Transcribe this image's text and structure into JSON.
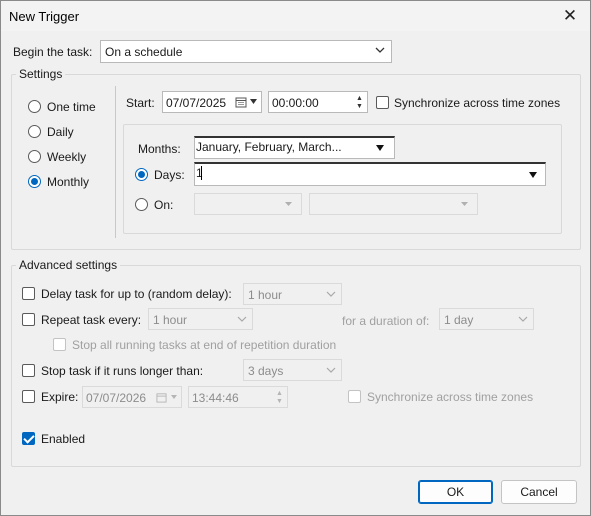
{
  "window": {
    "title": "New Trigger"
  },
  "begin_task": {
    "label": "Begin the task:",
    "value": "On a schedule"
  },
  "settings": {
    "group_title": "Settings",
    "schedule_options": [
      "One time",
      "Daily",
      "Weekly",
      "Monthly"
    ],
    "selected_option": "Monthly",
    "start_label": "Start:",
    "start_date": "07/07/2025",
    "start_time": "00:00:00",
    "sync_label": "Synchronize across time zones",
    "months_label": "Months:",
    "months_value": "January, February, March...",
    "days_label": "Days:",
    "days_value": "1",
    "on_label": "On:"
  },
  "advanced": {
    "group_title": "Advanced settings",
    "delay_label": "Delay task for up to (random delay):",
    "delay_value": "1 hour",
    "repeat_label": "Repeat task every:",
    "repeat_value": "1 hour",
    "duration_label": "for a duration of:",
    "duration_value": "1 day",
    "stop_running_label": "Stop all running tasks at end of repetition duration",
    "stop_longer_label": "Stop task if it runs longer than:",
    "stop_longer_value": "3 days",
    "expire_label": "Expire:",
    "expire_date": "07/07/2026",
    "expire_time": "13:44:46",
    "expire_sync_label": "Synchronize across time zones",
    "enabled_label": "Enabled"
  },
  "buttons": {
    "ok": "OK",
    "cancel": "Cancel"
  },
  "colors": {
    "accent": "#0067c0",
    "window_bg": "#f0f0f0"
  }
}
